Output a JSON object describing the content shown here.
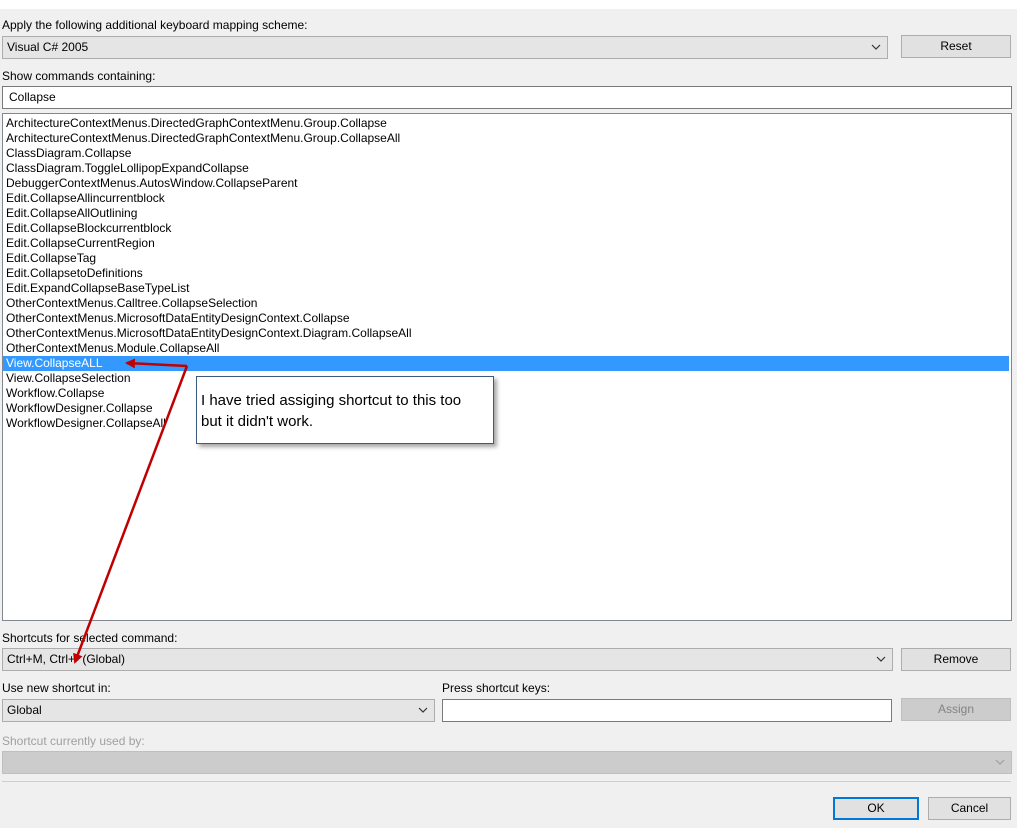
{
  "mapping": {
    "label": "Apply the following additional keyboard mapping scheme:",
    "scheme_value": "Visual C# 2005",
    "reset_label": "Reset"
  },
  "search": {
    "label": "Show commands containing:",
    "value": "Collapse"
  },
  "commands": [
    {
      "label": "ArchitectureContextMenus.DirectedGraphContextMenu.Group.Collapse",
      "selected": false
    },
    {
      "label": "ArchitectureContextMenus.DirectedGraphContextMenu.Group.CollapseAll",
      "selected": false
    },
    {
      "label": "ClassDiagram.Collapse",
      "selected": false
    },
    {
      "label": "ClassDiagram.ToggleLollipopExpandCollapse",
      "selected": false
    },
    {
      "label": "DebuggerContextMenus.AutosWindow.CollapseParent",
      "selected": false
    },
    {
      "label": "Edit.CollapseAllincurrentblock",
      "selected": false
    },
    {
      "label": "Edit.CollapseAllOutlining",
      "selected": false
    },
    {
      "label": "Edit.CollapseBlockcurrentblock",
      "selected": false
    },
    {
      "label": "Edit.CollapseCurrentRegion",
      "selected": false
    },
    {
      "label": "Edit.CollapseTag",
      "selected": false
    },
    {
      "label": "Edit.CollapsetoDefinitions",
      "selected": false
    },
    {
      "label": "Edit.ExpandCollapseBaseTypeList",
      "selected": false
    },
    {
      "label": "OtherContextMenus.Calltree.CollapseSelection",
      "selected": false
    },
    {
      "label": "OtherContextMenus.MicrosoftDataEntityDesignContext.Collapse",
      "selected": false
    },
    {
      "label": "OtherContextMenus.MicrosoftDataEntityDesignContext.Diagram.CollapseAll",
      "selected": false
    },
    {
      "label": "OtherContextMenus.Module.CollapseAll",
      "selected": false
    },
    {
      "label": "View.CollapseALL",
      "selected": true
    },
    {
      "label": "View.CollapseSelection",
      "selected": false
    },
    {
      "label": "Workflow.Collapse",
      "selected": false
    },
    {
      "label": "WorkflowDesigner.Collapse",
      "selected": false
    },
    {
      "label": "WorkflowDesigner.CollapseAll",
      "selected": false
    }
  ],
  "annotation": {
    "line1": "I have tried assiging shortcut to this too",
    "line2": "but it didn't work.",
    "color": "#c00000"
  },
  "shortcuts": {
    "label": "Shortcuts for selected command:",
    "value": "Ctrl+M, Ctrl+- (Global)",
    "remove_label": "Remove"
  },
  "new_shortcut": {
    "use_in_label": "Use new shortcut in:",
    "use_in_value": "Global",
    "press_keys_label": "Press shortcut keys:",
    "press_keys_value": "",
    "assign_label": "Assign"
  },
  "currently_used": {
    "label": "Shortcut currently used by:",
    "value": ""
  },
  "footer": {
    "ok_label": "OK",
    "cancel_label": "Cancel"
  },
  "colors": {
    "selection": "#3399ff",
    "default_button_border": "#0078d7",
    "arrow": "#c00000"
  }
}
